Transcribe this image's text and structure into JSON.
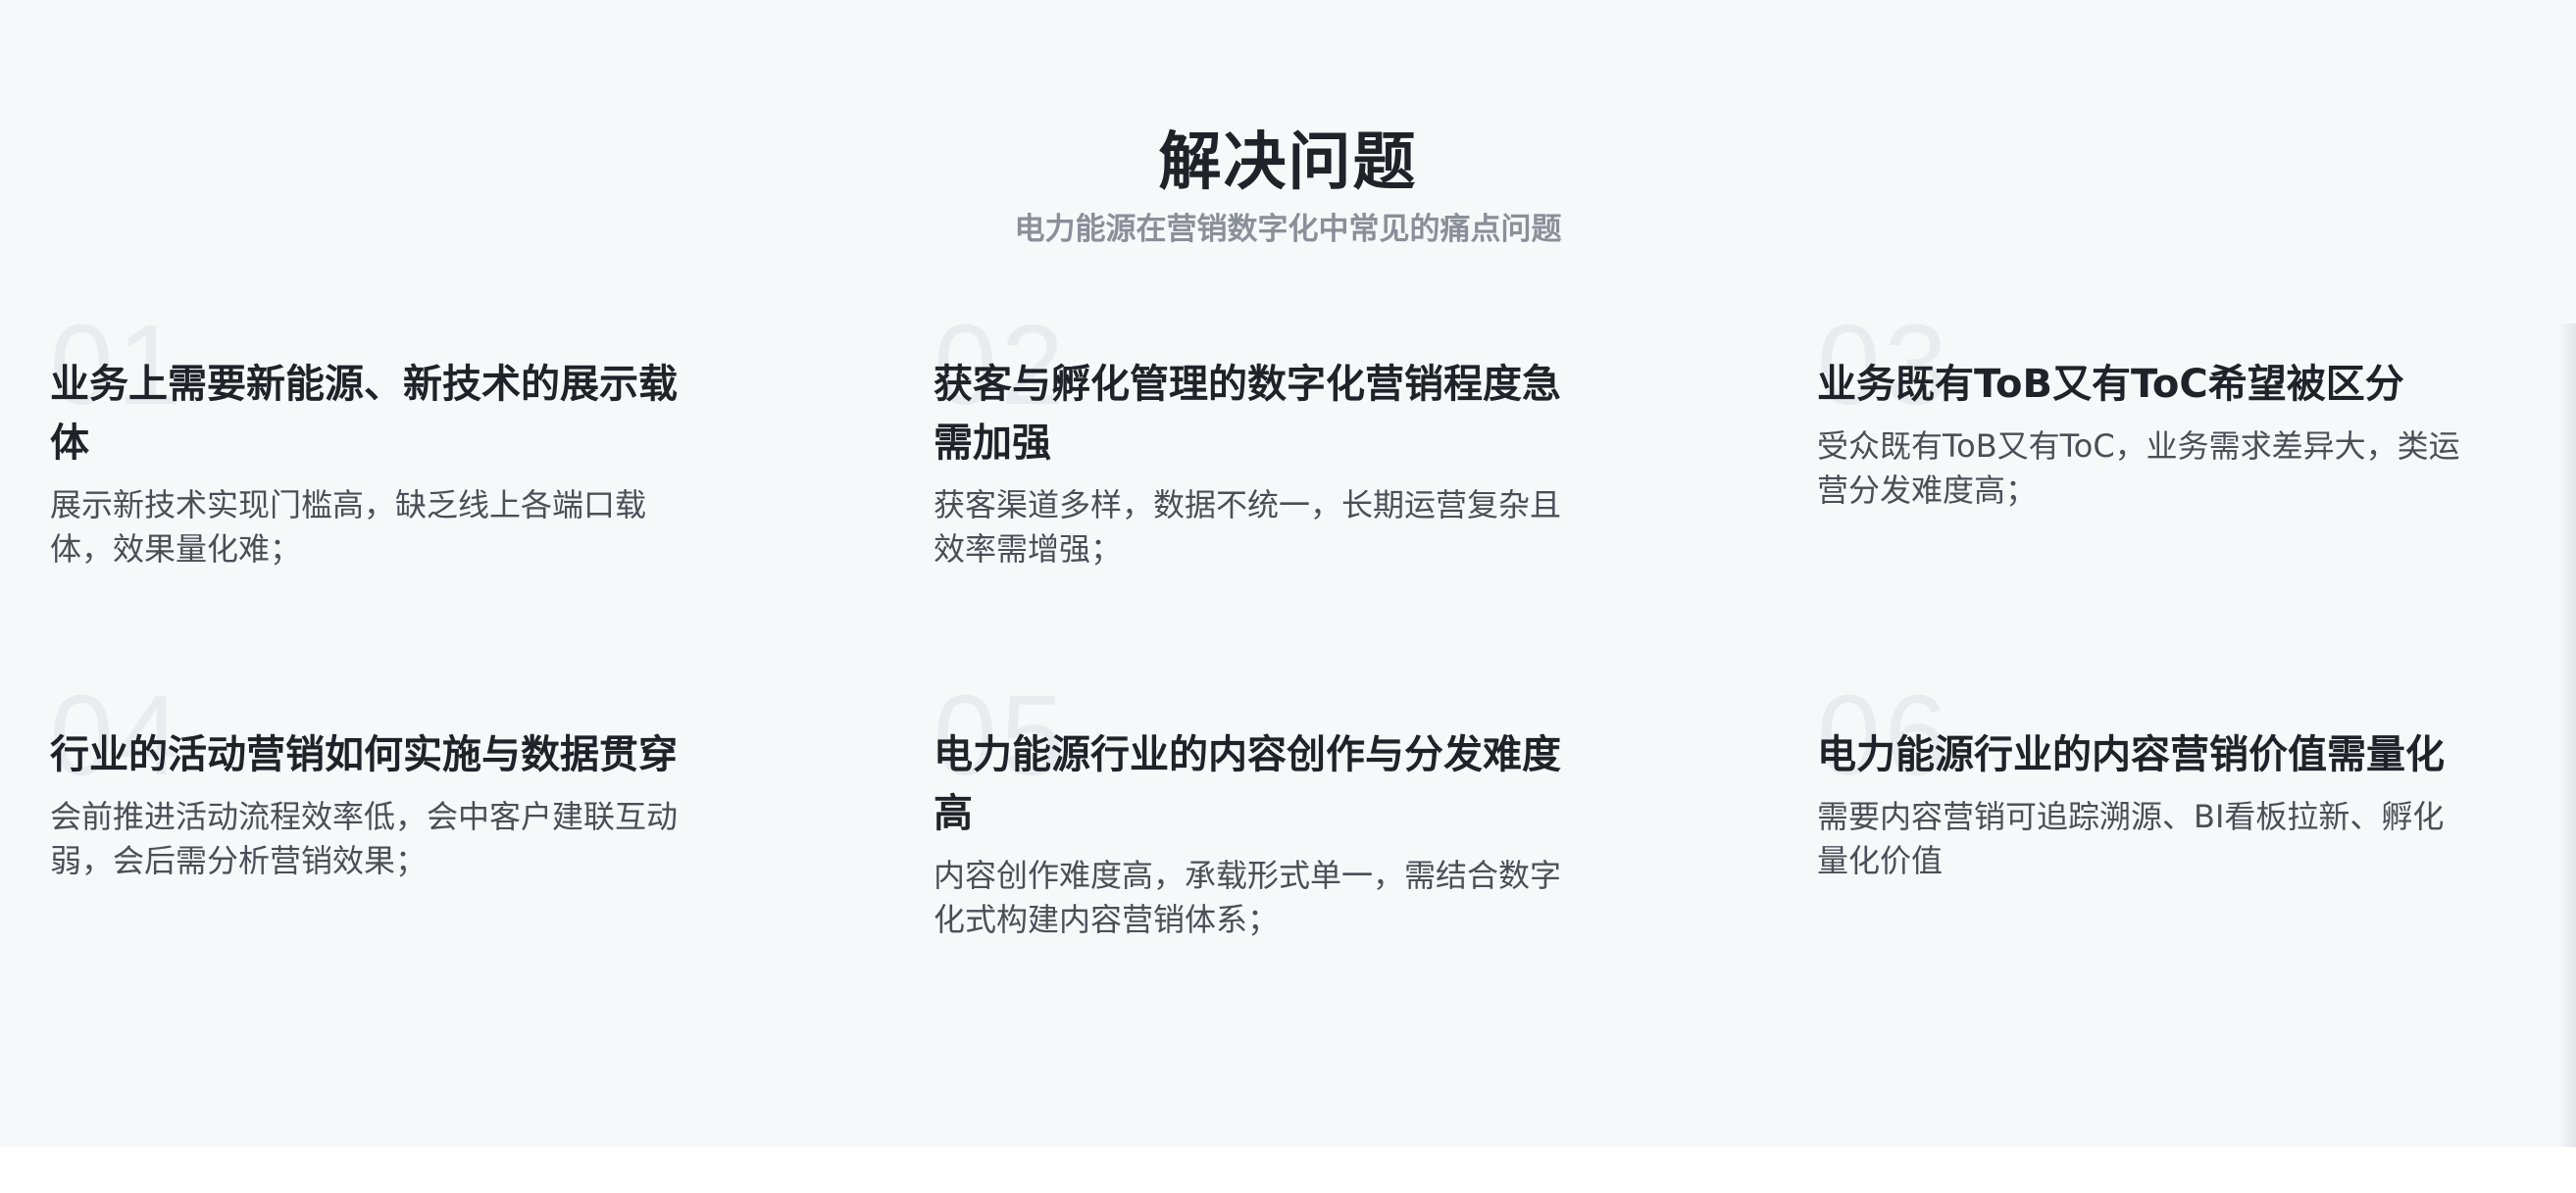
{
  "header": {
    "title": "解决问题",
    "subtitle": "电力能源在营销数字化中常见的痛点问题"
  },
  "cards": [
    {
      "number": "01",
      "title": "业务上需要新能源、新技术的展示载体",
      "description": "展示新技术实现门槛高，缺乏线上各端口载体，效果量化难；"
    },
    {
      "number": "02",
      "title": "获客与孵化管理的数字化营销程度急需加强",
      "description": "获客渠道多样，数据不统一，长期运营复杂且效率需增强；"
    },
    {
      "number": "03",
      "title": "业务既有ToB又有ToC希望被区分",
      "description": "受众既有ToB又有ToC，业务需求差异大，类运营分发难度高；"
    },
    {
      "number": "04",
      "title": "行业的活动营销如何实施与数据贯穿",
      "description": "会前推进活动流程效率低，会中客户建联互动弱，会后需分析营销效果；"
    },
    {
      "number": "05",
      "title": "电力能源行业的内容创作与分发难度高",
      "description": "内容创作难度高，承载形式单一，需结合数字化式构建内容营销体系；"
    },
    {
      "number": "06",
      "title": "电力能源行业的内容营销价值需量化",
      "description": "需要内容营销可追踪溯源、BI看板拉新、孵化量化价值"
    }
  ]
}
